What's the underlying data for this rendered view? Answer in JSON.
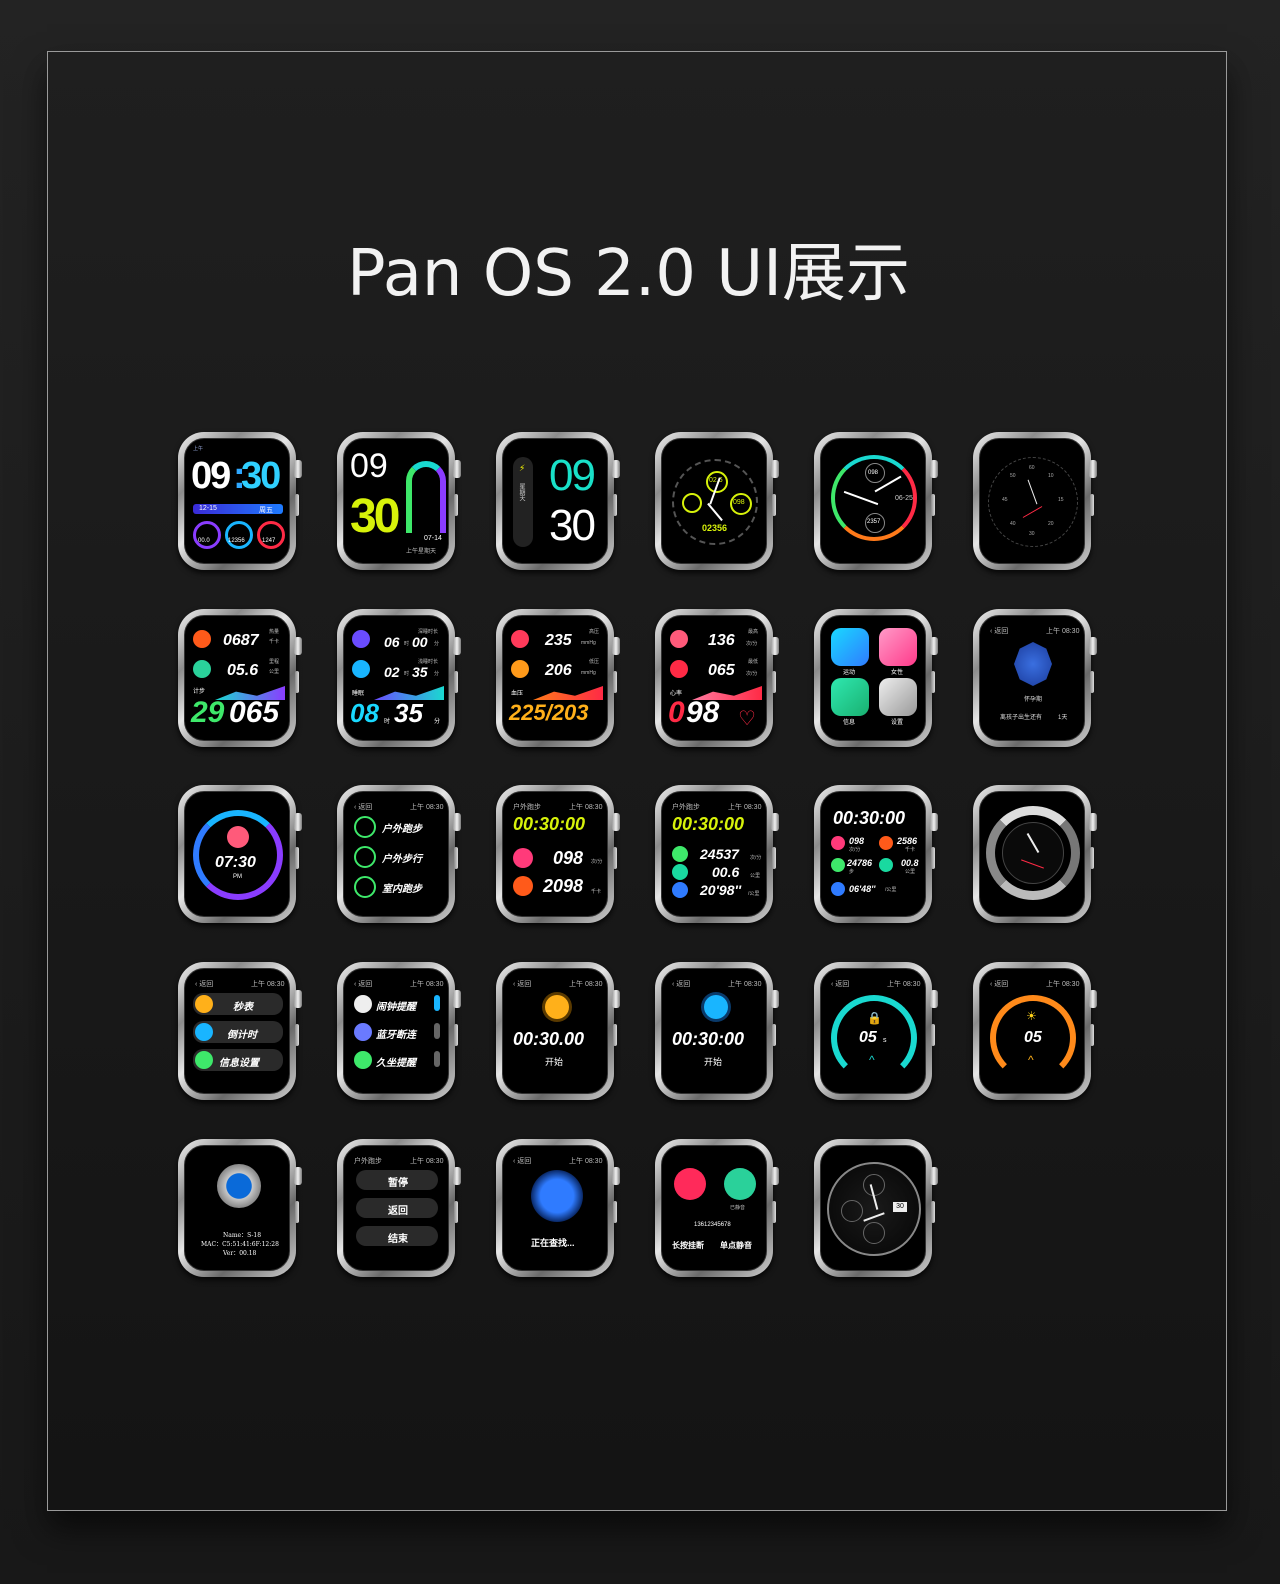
{
  "page_title": "Pan OS  2.0 UI展示",
  "watches": {
    "w1": {
      "label_am": "上午",
      "time_hh": "09",
      "time_mm": "30",
      "date": "12-15",
      "weekday": "周五",
      "v1": "00.0",
      "v2": "12356",
      "v3": "1247"
    },
    "w2": {
      "hh": "09",
      "mm": "30",
      "date": "07-14",
      "sub": "上午星期天"
    },
    "w3": {
      "weekday": "星期天",
      "hh": "09",
      "mm": "30"
    },
    "w4": {
      "top": "02.6",
      "top_unit": "公里",
      "right": "098",
      "right_unit": "次/分",
      "bottom": "02356"
    },
    "w5": {
      "top": "098",
      "date": "06-25",
      "bottom": "2357"
    },
    "w6": {
      "nums": [
        "60",
        "10",
        "50",
        "45",
        "15",
        "40",
        "20",
        "30"
      ]
    },
    "w7": {
      "l1": "热量",
      "v1": "0687",
      "u1": "千卡",
      "l2": "里程",
      "v2": "05.6",
      "u2": "公里",
      "l3": "计步",
      "v3a": "29",
      "v3b": "065"
    },
    "w8": {
      "l1": "深睡时长",
      "v1": "06",
      "u1a": "时",
      "v1b": "00",
      "u1b": "分",
      "l2": "浅睡时长",
      "v2": "02",
      "u2a": "时",
      "v2b": "35",
      "u2b": "分",
      "l3": "睡眠",
      "v3": "08",
      "u3a": "时",
      "v3b": "35",
      "u3b": "分"
    },
    "w9": {
      "l1": "高压",
      "v1": "235",
      "u1": "mmHg",
      "l2": "低压",
      "v2": "206",
      "u2": "mmHg",
      "l3": "血压",
      "v3": "225/203"
    },
    "w10": {
      "l1": "最高",
      "v1": "136",
      "u1": "次/分",
      "l2": "最低",
      "v2": "065",
      "u2": "次/分",
      "l3": "心率",
      "v3a": "0",
      "v3b": "98"
    },
    "w11": {
      "a1": "运动",
      "a2": "女性",
      "a3": "信息",
      "a4": "设置"
    },
    "w12": {
      "back": "返回",
      "time": "上午 08:30",
      "label": "怀孕期",
      "desc": "离孩子出生还有",
      "days": "1天"
    },
    "w13": {
      "time": "07:30",
      "ampm": "PM"
    },
    "w14": {
      "back": "返回",
      "time": "上午 08:30",
      "items": [
        "户外跑步",
        "户外步行",
        "室内跑步"
      ]
    },
    "w15": {
      "head": "户外跑步",
      "time": "上午 08:30",
      "timer": "00:30:00",
      "v1": "098",
      "u1": "次/分",
      "v2": "2098",
      "u2": "千卡"
    },
    "w16": {
      "head": "户外跑步",
      "time": "上午 08:30",
      "timer": "00:30:00",
      "v1": "24537",
      "u1": "次/分",
      "v2": "00.6",
      "u2": "公里",
      "v3": "20'98''",
      "u3": "/公里"
    },
    "w17": {
      "timer": "00:30:00",
      "v1": "098",
      "u1": "次/分",
      "v2": "2586",
      "u2": "千卡",
      "v3": "24786",
      "u3": "步",
      "v4": "00.8",
      "u4": "公里",
      "v5": "06'48''",
      "u5": "/公里"
    },
    "w18": {},
    "w19": {
      "back": "返回",
      "time": "上午 08:30",
      "items": [
        "秒表",
        "倒计时",
        "信息设置"
      ]
    },
    "w20": {
      "back": "返回",
      "time": "上午 08:30",
      "items": [
        "闹钟提醒",
        "蓝牙断连",
        "久坐提醒"
      ]
    },
    "w21": {
      "back": "返回",
      "time": "上午 08:30",
      "timer": "00:30.00",
      "action": "开始"
    },
    "w22": {
      "back": "返回",
      "time": "上午 08:30",
      "timer": "00:30:00",
      "action": "开始"
    },
    "w23": {
      "back": "返回",
      "time": "上午 08:30",
      "value": "05",
      "unit": "s"
    },
    "w24": {
      "back": "返回",
      "time": "上午 08:30",
      "value": "05"
    },
    "w25": {
      "name": "Name：S-18",
      "mac": "MAC：C5:51:41:6F:12:28",
      "ver": "Ver：00.18"
    },
    "w26": {
      "head": "户外跑步",
      "time": "上午 08:30",
      "items": [
        "暂停",
        "返回",
        "结束"
      ]
    },
    "w27": {
      "back": "返回",
      "time": "上午 08:30",
      "label": "正在查找..."
    },
    "w28": {
      "status": "已静音",
      "number": "13612345678",
      "act1": "长按挂断",
      "act2": "单点静音"
    },
    "w29": {
      "date": "30"
    }
  },
  "colors": {
    "green": "#3ee86a",
    "cyan": "#19d9d0",
    "yellow": "#d7f20a",
    "orange": "#ff7a1a",
    "red": "#ff2a45",
    "purple": "#8a3cff",
    "blue": "#2f7bff"
  }
}
